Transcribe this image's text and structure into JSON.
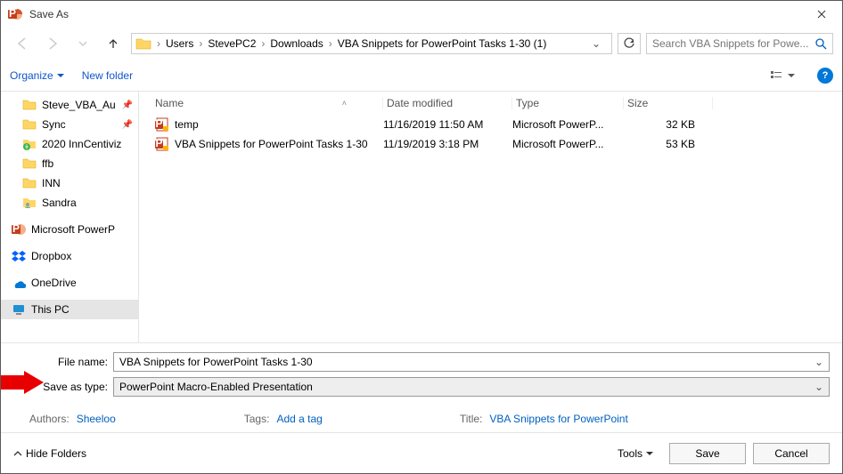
{
  "title": "Save As",
  "breadcrumb": [
    "Users",
    "StevePC2",
    "Downloads",
    "VBA Snippets for PowerPoint Tasks 1-30 (1)"
  ],
  "search_placeholder": "Search VBA Snippets for Powe...",
  "toolbar": {
    "organize": "Organize",
    "new_folder": "New folder"
  },
  "tree": [
    {
      "label": "Steve_VBA_Au",
      "icon": "folder",
      "pinned": true
    },
    {
      "label": "Sync",
      "icon": "folder",
      "pinned": true
    },
    {
      "label": "2020 InnCentiviz",
      "icon": "web-folder",
      "pinned": false
    },
    {
      "label": "ffb",
      "icon": "folder",
      "pinned": false
    },
    {
      "label": "INN",
      "icon": "folder",
      "pinned": false
    },
    {
      "label": "Sandra",
      "icon": "user-folder",
      "pinned": false
    },
    {
      "label": "Microsoft PowerP",
      "icon": "ppt-app",
      "pinned": false
    },
    {
      "label": "Dropbox",
      "icon": "dropbox",
      "pinned": false
    },
    {
      "label": "OneDrive",
      "icon": "onedrive",
      "pinned": false
    },
    {
      "label": "This PC",
      "icon": "pc",
      "pinned": false
    }
  ],
  "tree_selected_index": 9,
  "columns": {
    "name": "Name",
    "date": "Date modified",
    "type": "Type",
    "size": "Size"
  },
  "files": [
    {
      "name": "temp",
      "date": "11/16/2019 11:50 AM",
      "type": "Microsoft PowerP...",
      "size": "32 KB"
    },
    {
      "name": "VBA Snippets for PowerPoint Tasks 1-30",
      "date": "11/19/2019 3:18 PM",
      "type": "Microsoft PowerP...",
      "size": "53 KB"
    }
  ],
  "filename_label": "File name:",
  "filename_value": "VBA Snippets for PowerPoint Tasks 1-30",
  "savetype_label": "Save as type:",
  "savetype_value": "PowerPoint Macro-Enabled Presentation",
  "meta": {
    "authors_label": "Authors:",
    "authors_value": "Sheeloo",
    "tags_label": "Tags:",
    "tags_value": "Add a tag",
    "title_label": "Title:",
    "title_value": "VBA Snippets for PowerPoint"
  },
  "footer": {
    "hide_folders": "Hide Folders",
    "tools": "Tools",
    "save": "Save",
    "cancel": "Cancel"
  }
}
